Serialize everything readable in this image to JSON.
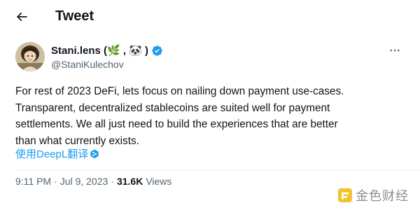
{
  "header": {
    "title": "Tweet",
    "back_icon": "arrow-left-icon"
  },
  "author": {
    "display_name": "Stani.lens (🌿 , 🐼 )",
    "handle": "@StaniKulechov",
    "verified": true,
    "verified_color": "#1d9bf0",
    "avatar_icon": "profile-avatar",
    "more_icon": "more-horizontal-icon"
  },
  "tweet": {
    "lines": [
      "For rest of 2023 DeFi, lets focus on nailing down payment use-cases.",
      "Transparent, decentralized stablecoins are suited well for payment",
      "settlements. We all just need to build the experiences that are better",
      "than what currently exists."
    ],
    "translate_label": "使用DeepL翻译",
    "translate_icon": "deepl-icon"
  },
  "meta": {
    "time": "9:11 PM",
    "separator": "·",
    "date": "Jul 9, 2023",
    "views_count": "31.6K",
    "views_label": "Views"
  },
  "watermark": {
    "text": "金色财经",
    "logo_icon": "jinse-logo"
  },
  "colors": {
    "text_primary": "#0f1419",
    "text_secondary": "#536471",
    "link": "#1d9bf0",
    "divider": "#eff3f4"
  }
}
